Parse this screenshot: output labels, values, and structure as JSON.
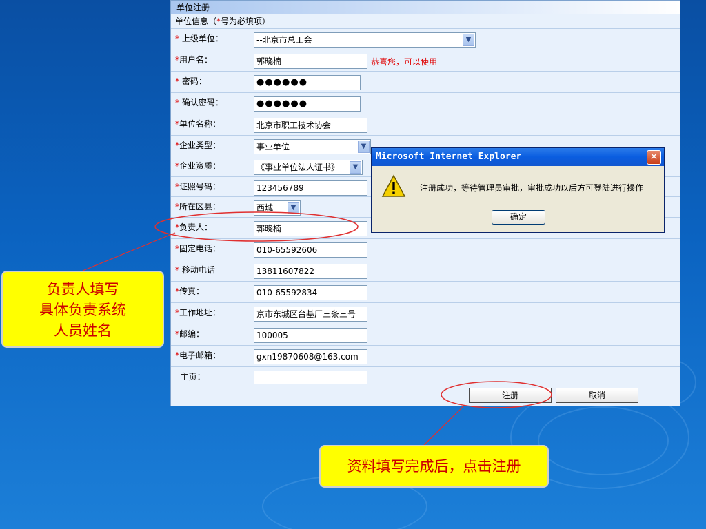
{
  "form": {
    "title": "单位注册",
    "section_note_prefix": "单位信息（",
    "section_note_star": "*",
    "section_note_suffix": "号为必填项）",
    "rows": [
      {
        "star": "*",
        "label": " 上级单位：",
        "value": "--北京市总工会",
        "kind": "select"
      },
      {
        "star": "*",
        "label": "用户名：",
        "value": "郭晓楠",
        "kind": "text",
        "message": "恭喜您，可以使用"
      },
      {
        "star": "*",
        "label": " 密码：",
        "value": "●●●●●●",
        "kind": "password"
      },
      {
        "star": "*",
        "label": " 确认密码：",
        "value": "●●●●●●",
        "kind": "password"
      },
      {
        "star": "*",
        "label": "单位名称：",
        "value": "北京市职工技术协会",
        "kind": "text"
      },
      {
        "star": "*",
        "label": "企业类型：",
        "value": "事业单位",
        "kind": "select"
      },
      {
        "star": "*",
        "label": "企业资质：",
        "value": "《事业单位法人证书》",
        "kind": "select"
      },
      {
        "star": "*",
        "label": "证照号码：",
        "value": "123456789",
        "kind": "text"
      },
      {
        "star": "*",
        "label": "所在区县：",
        "value": "西城",
        "kind": "select"
      },
      {
        "star": "*",
        "label": "负责人：",
        "value": "郭晓楠",
        "kind": "text"
      },
      {
        "star": "*",
        "label": "固定电话：",
        "value": "010-65592606",
        "kind": "text"
      },
      {
        "star": "*",
        "label": " 移动电话",
        "value": "13811607822",
        "kind": "text"
      },
      {
        "star": "*",
        "label": "传真：",
        "value": "010-65592834",
        "kind": "text"
      },
      {
        "star": "*",
        "label": "工作地址：",
        "value": "京市东城区台基厂三条三号",
        "kind": "text"
      },
      {
        "star": "*",
        "label": "邮编：",
        "value": "100005",
        "kind": "text"
      },
      {
        "star": "*",
        "label": "电子邮箱：",
        "value": "gxn19870608@163.com",
        "kind": "text"
      },
      {
        "star": "",
        "label": "  主页：",
        "value": "",
        "kind": "text"
      }
    ],
    "register_label": "注册",
    "cancel_label": "取消"
  },
  "dialog": {
    "title": "Microsoft Internet Explorer",
    "message": "注册成功，等待管理员审批，审批成功以后方可登陆进行操作",
    "ok_label": "确定"
  },
  "callouts": {
    "person_in_charge": [
      "负责人填写",
      "具体负责系统",
      "人员姓名"
    ],
    "register": "资料填写完成后，点击注册"
  },
  "colors": {
    "background": "#0b63c1",
    "required_star": "#e00000",
    "callout_fill": "#ffff00",
    "callout_text": "#cc0000",
    "annotation_line": "#e03030"
  }
}
